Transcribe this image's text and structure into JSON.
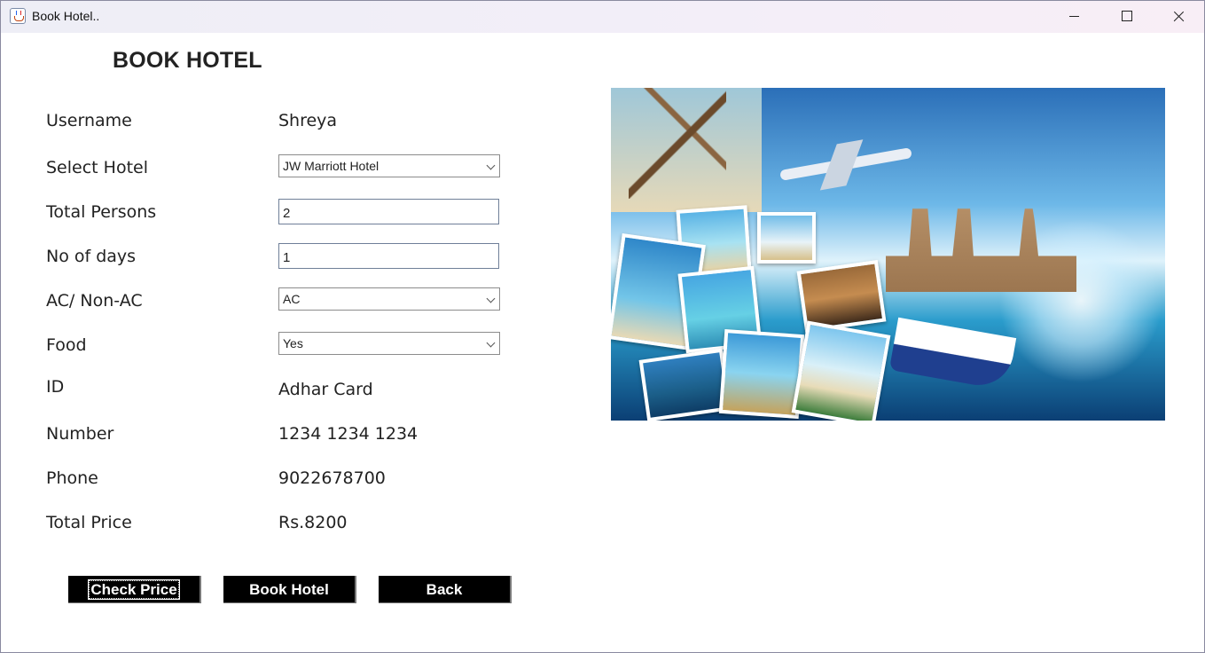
{
  "window": {
    "title": "Book Hotel..",
    "controls": [
      "minimize-icon",
      "maximize-icon",
      "close-icon"
    ]
  },
  "page": {
    "heading": "BOOK HOTEL"
  },
  "form": {
    "username": {
      "label": "Username",
      "value": "Shreya"
    },
    "hotel": {
      "label": "Select Hotel",
      "selected": "JW Marriott Hotel"
    },
    "persons": {
      "label": "Total Persons",
      "value": "2"
    },
    "days": {
      "label": "No of days",
      "value": "1"
    },
    "ac": {
      "label": "AC/ Non-AC",
      "selected": "AC"
    },
    "food": {
      "label": "Food",
      "selected": "Yes"
    },
    "id": {
      "label": "ID",
      "value": "Adhar Card"
    },
    "number": {
      "label": "Number",
      "value": "1234 1234 1234"
    },
    "phone": {
      "label": "Phone",
      "value": "9022678700"
    },
    "price": {
      "label": "Total Price",
      "value": "Rs.8200"
    }
  },
  "buttons": {
    "check_price": "Check Price",
    "book_hotel": "Book Hotel",
    "back": "Back"
  },
  "colors": {
    "button_bg": "#000000",
    "button_text": "#ffffff",
    "text": "#222222"
  }
}
